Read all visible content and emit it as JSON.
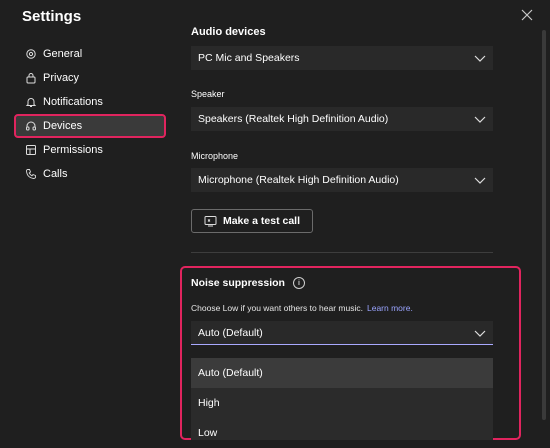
{
  "window": {
    "title": "Settings"
  },
  "sidebar": {
    "items": [
      {
        "label": "General",
        "icon": "gear-icon"
      },
      {
        "label": "Privacy",
        "icon": "lock-icon"
      },
      {
        "label": "Notifications",
        "icon": "bell-icon"
      },
      {
        "label": "Devices",
        "icon": "headset-icon",
        "active": true
      },
      {
        "label": "Permissions",
        "icon": "permissions-icon"
      },
      {
        "label": "Calls",
        "icon": "phone-icon"
      }
    ]
  },
  "audio": {
    "title": "Audio devices",
    "device": "PC Mic and Speakers",
    "speaker_label": "Speaker",
    "speaker": "Speakers (Realtek High Definition Audio)",
    "mic_label": "Microphone",
    "mic": "Microphone (Realtek High Definition Audio)",
    "test_call": "Make a test call"
  },
  "noise": {
    "title": "Noise suppression",
    "info_icon": "i",
    "desc": "Choose Low if you want others to hear music.",
    "learn_more": "Learn more.",
    "selected": "Auto (Default)",
    "options": [
      "Auto (Default)",
      "High",
      "Low"
    ]
  },
  "colors": {
    "accent_highlight": "#e0245e",
    "link": "#9aa4ff",
    "background": "#1f1f1f"
  }
}
